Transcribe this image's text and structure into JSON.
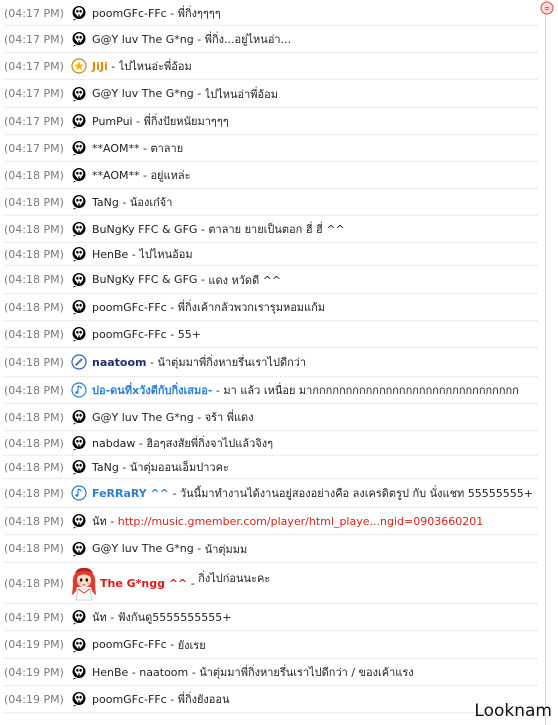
{
  "corner_icon": "smiley-lips-icon",
  "watermark": "Looknam",
  "messages": [
    {
      "time": "(04:17 PM)",
      "avatar": "skull-icon",
      "name": "poomGFc-FFc",
      "sep": " - ",
      "text": "พี่กิ่งๆๆๆๆ"
    },
    {
      "time": "(04:17 PM)",
      "avatar": "skull-icon",
      "name": "G@Y luv The G*ng",
      "sep": " - ",
      "text": "พี่กิ่ง...อยู่ไหนอ่า..."
    },
    {
      "time": "(04:17 PM)",
      "avatar": "star-icon",
      "name": "JiJi",
      "sep": " - ",
      "text": "ไปไหนอ่ะพี่อ้อม"
    },
    {
      "time": "(04:17 PM)",
      "avatar": "skull-icon",
      "name": "G@Y luv The G*ng",
      "sep": " - ",
      "text": "ไปไหนอ่าพี่อ้อม"
    },
    {
      "time": "(04:17 PM)",
      "avatar": "skull-icon",
      "name": "PumPui",
      "sep": " - ",
      "text": "พี่กิ่งปัยหนัยมาๆๆๆ"
    },
    {
      "time": "(04:17 PM)",
      "avatar": "skull-icon",
      "name": "**AOM**",
      "sep": " - ",
      "text": "ตาลาย"
    },
    {
      "time": "(04:18 PM)",
      "avatar": "skull-icon",
      "name": "**AOM**",
      "sep": " - ",
      "text": "อยู่แหล่ะ"
    },
    {
      "time": "(04:18 PM)",
      "avatar": "skull-icon",
      "name": "TaNg",
      "sep": " - ",
      "text": "น้องเก๋จ้า"
    },
    {
      "time": "(04:18 PM)",
      "avatar": "skull-icon",
      "name": "BuNgKy FFC & GFG",
      "sep": " - ",
      "text": "ตาลาย ยายเป็นตอก ฮี่ ฮี่ ^^"
    },
    {
      "time": "(04:18 PM)",
      "avatar": "skull-icon",
      "name": "HenBe",
      "sep": " - ",
      "text": "ไปไหนอ้อม"
    },
    {
      "time": "(04:18 PM)",
      "avatar": "skull-icon",
      "name": "BuNgKy FFC & GFG",
      "sep": " - ",
      "text": "แดง หวัดดี ^^"
    },
    {
      "time": "(04:18 PM)",
      "avatar": "skull-icon",
      "name": "poomGFc-FFc",
      "sep": " - ",
      "text": "พี่กิ่งเค้ากลัวพวกเรารุมหอมแก้ม"
    },
    {
      "time": "(04:18 PM)",
      "avatar": "skull-icon",
      "name": "poomGFc-FFc",
      "sep": " - ",
      "text": "55+"
    },
    {
      "time": "(04:18 PM)",
      "avatar": "pencil-icon",
      "name": "naatoom",
      "sep": " - ",
      "text": "น้าตุ่มมาพี่กิ่งหายรึ่นเราไปดีกว่า"
    },
    {
      "time": "(04:18 PM)",
      "avatar": "music-note-icon",
      "name": "ปอ-ดนที่xวังดีกับกิ่งเสมอ-",
      "sep": " - ",
      "text": "มา แล้ว เหนื่อย มากกกกกกกกกกกกกกกกกกกกกกกกกกกกกกก"
    },
    {
      "time": "(04:18 PM)",
      "avatar": "skull-icon",
      "name": "G@Y luv The G*ng",
      "sep": " - ",
      "text": "จร้า พี่แดง"
    },
    {
      "time": "(04:18 PM)",
      "avatar": "skull-icon",
      "name": "nabdaw",
      "sep": " - ",
      "text": "ฮิอๆสงสัยพี่กิ่งจาไปแล้วจิงๆ"
    },
    {
      "time": "(04:18 PM)",
      "avatar": "skull-icon",
      "name": "TaNg",
      "sep": " - ",
      "text": "น้าตุ่มออนเอ็มปาวคะ"
    },
    {
      "time": "(04:18 PM)",
      "avatar": "music-note-icon",
      "name": "FeRRaRY ^^",
      "sep": " - ",
      "text": "วันนี้มาทำงานได้งานอยู่สองอย่างคือ ลงเครดิตรูป กับ นั่งแชท 55555555+"
    },
    {
      "time": "(04:18 PM)",
      "avatar": "skull-icon",
      "name": "นัท",
      "sep": " - ",
      "text": "http://music.gmember.com/player/html_playe...ngid=0903660201"
    },
    {
      "time": "(04:18 PM)",
      "avatar": "skull-icon",
      "name": "G@Y luv The G*ng",
      "sep": " - ",
      "text": "น้าตุ่มมม"
    },
    {
      "time": "(04:18 PM)",
      "avatar": "red-hair-girl-icon",
      "name": "The G*ngg ^^",
      "sep": " - ",
      "text": "กิ่งไปก่อนนะคะ"
    },
    {
      "time": "(04:19 PM)",
      "avatar": "skull-icon",
      "name": "นัท",
      "sep": " - ",
      "text": "ฟังกันดู5555555555+"
    },
    {
      "time": "(04:19 PM)",
      "avatar": "skull-icon",
      "name": "poomGFc-FFc",
      "sep": " - ",
      "text": "ยังเรย"
    },
    {
      "time": "(04:19 PM)",
      "avatar": "skull-icon",
      "name": "HenBe",
      "sep": " - ",
      "text": "naatoom - น้าตุ่มมาพี่กิ่งหายรึ่นเราไปดีกว่า / ของเค้าแรง"
    },
    {
      "time": "(04:19 PM)",
      "avatar": "skull-icon",
      "name": "poomGFc-FFc",
      "sep": " - ",
      "text": "พี่กิ่งยังออน"
    }
  ]
}
